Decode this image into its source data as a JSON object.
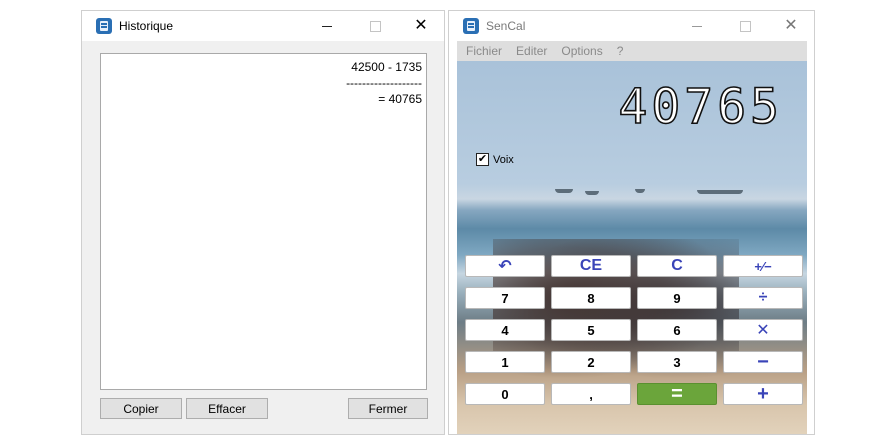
{
  "history_window": {
    "title": "Historique",
    "lines": [
      "42500 - 1735",
      "-------------------",
      "= 40765"
    ],
    "buttons": {
      "copy": "Copier",
      "clear": "Effacer",
      "close": "Fermer"
    }
  },
  "calculator_window": {
    "title": "SenCal",
    "menu": [
      "Fichier",
      "Editer",
      "Options",
      "?"
    ],
    "display": "40765",
    "voice_label": "Voix",
    "voice_checked": true,
    "keys": {
      "back": "↶",
      "ce": "CE",
      "c": "C",
      "plusminus": "+∕−",
      "seven": "7",
      "eight": "8",
      "nine": "9",
      "divide": "÷",
      "four": "4",
      "five": "5",
      "six": "6",
      "multiply": "✕",
      "one": "1",
      "two": "2",
      "three": "3",
      "minus": "−",
      "zero": "0",
      "comma": ",",
      "equals": "=",
      "plus": "+"
    }
  },
  "colors": {
    "operator_keys": "#3a44b8",
    "equals_key": "#6ba53b"
  }
}
